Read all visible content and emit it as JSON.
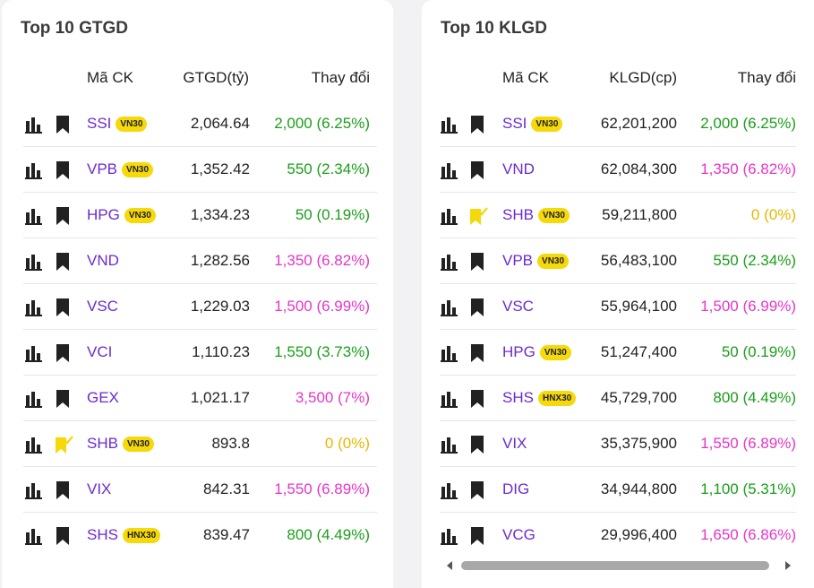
{
  "gtgd": {
    "title": "Top 10 GTGD",
    "headers": {
      "code": "Mã CK",
      "value": "GTGD(tỷ)",
      "change": "Thay đổi"
    },
    "rows": [
      {
        "code": "SSI",
        "badge": "VN30",
        "value": "2,064.64",
        "change": "2,000 (6.25%)",
        "status": "up",
        "bookmarked": false
      },
      {
        "code": "VPB",
        "badge": "VN30",
        "value": "1,352.42",
        "change": "550 (2.34%)",
        "status": "up",
        "bookmarked": false
      },
      {
        "code": "HPG",
        "badge": "VN30",
        "value": "1,334.23",
        "change": "50 (0.19%)",
        "status": "up",
        "bookmarked": false
      },
      {
        "code": "VND",
        "badge": "",
        "value": "1,282.56",
        "change": "1,350 (6.82%)",
        "status": "ceil",
        "bookmarked": false
      },
      {
        "code": "VSC",
        "badge": "",
        "value": "1,229.03",
        "change": "1,500 (6.99%)",
        "status": "ceil",
        "bookmarked": false
      },
      {
        "code": "VCI",
        "badge": "",
        "value": "1,110.23",
        "change": "1,550 (3.73%)",
        "status": "up",
        "bookmarked": false
      },
      {
        "code": "GEX",
        "badge": "",
        "value": "1,021.17",
        "change": "3,500 (7%)",
        "status": "ceil",
        "bookmarked": false
      },
      {
        "code": "SHB",
        "badge": "VN30",
        "value": "893.8",
        "change": "0 (0%)",
        "status": "ref",
        "bookmarked": true
      },
      {
        "code": "VIX",
        "badge": "",
        "value": "842.31",
        "change": "1,550 (6.89%)",
        "status": "ceil",
        "bookmarked": false
      },
      {
        "code": "SHS",
        "badge": "HNX30",
        "value": "839.47",
        "change": "800 (4.49%)",
        "status": "up",
        "bookmarked": false
      }
    ]
  },
  "klgd": {
    "title": "Top 10 KLGD",
    "headers": {
      "code": "Mã CK",
      "value": "KLGD(cp)",
      "change": "Thay đổi"
    },
    "rows": [
      {
        "code": "SSI",
        "badge": "VN30",
        "value": "62,201,200",
        "change": "2,000 (6.25%)",
        "status": "up",
        "bookmarked": false
      },
      {
        "code": "VND",
        "badge": "",
        "value": "62,084,300",
        "change": "1,350 (6.82%)",
        "status": "ceil",
        "bookmarked": false
      },
      {
        "code": "SHB",
        "badge": "VN30",
        "value": "59,211,800",
        "change": "0 (0%)",
        "status": "ref",
        "bookmarked": true
      },
      {
        "code": "VPB",
        "badge": "VN30",
        "value": "56,483,100",
        "change": "550 (2.34%)",
        "status": "up",
        "bookmarked": false
      },
      {
        "code": "VSC",
        "badge": "",
        "value": "55,964,100",
        "change": "1,500 (6.99%)",
        "status": "ceil",
        "bookmarked": false
      },
      {
        "code": "HPG",
        "badge": "VN30",
        "value": "51,247,400",
        "change": "50 (0.19%)",
        "status": "up",
        "bookmarked": false
      },
      {
        "code": "SHS",
        "badge": "HNX30",
        "value": "45,729,700",
        "change": "800 (4.49%)",
        "status": "up",
        "bookmarked": false
      },
      {
        "code": "VIX",
        "badge": "",
        "value": "35,375,900",
        "change": "1,550 (6.89%)",
        "status": "ceil",
        "bookmarked": false
      },
      {
        "code": "DIG",
        "badge": "",
        "value": "34,944,800",
        "change": "1,100 (5.31%)",
        "status": "up",
        "bookmarked": false
      },
      {
        "code": "VCG",
        "badge": "",
        "value": "29,996,400",
        "change": "1,650 (6.86%)",
        "status": "ceil",
        "bookmarked": false
      }
    ]
  },
  "icons": {
    "chart": "bar-chart-icon",
    "bookmark": "bookmark-icon",
    "bookmark_checked": "bookmark-check-icon"
  },
  "colors": {
    "up": "#1a9e1a",
    "ceil": "#e535c8",
    "ref": "#e6b800",
    "code": "#6b2bd0",
    "badge": "#f5d90a"
  }
}
